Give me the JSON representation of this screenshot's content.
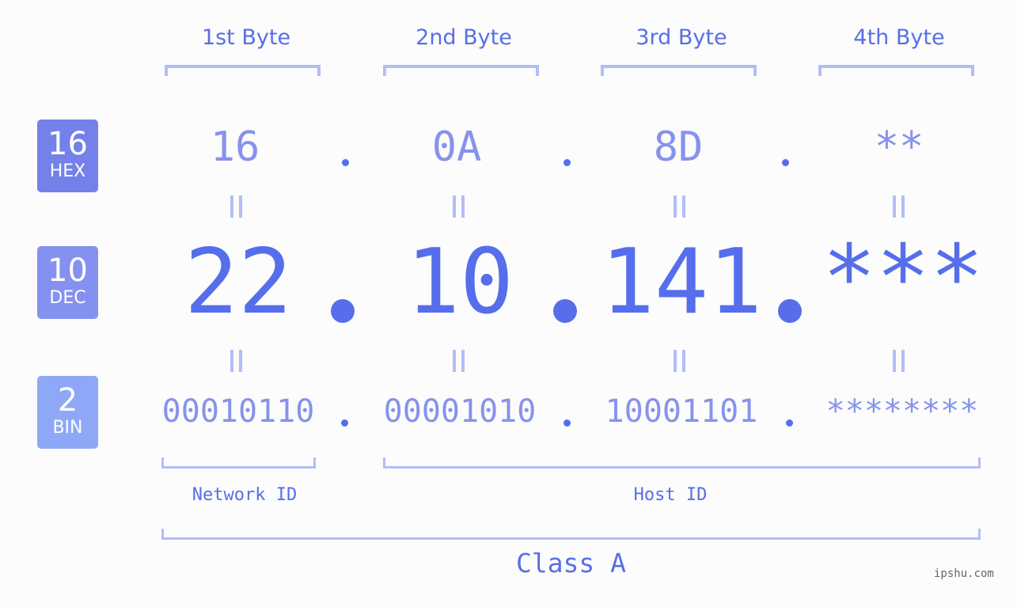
{
  "byte_headers": [
    "1st Byte",
    "2nd Byte",
    "3rd Byte",
    "4th Byte"
  ],
  "rows": {
    "hex": {
      "base": "16",
      "label": "HEX",
      "color": "#7481ea",
      "values": [
        "16",
        "0A",
        "8D",
        "**"
      ]
    },
    "dec": {
      "base": "10",
      "label": "DEC",
      "color": "#8491f0",
      "values": [
        "22",
        "10",
        "141",
        "***"
      ]
    },
    "bin": {
      "base": "2",
      "label": "BIN",
      "color": "#8fa7f7",
      "values": [
        "00010110",
        "00001010",
        "10001101",
        "********"
      ]
    }
  },
  "ip_address": "22.10.141.***",
  "network_id_label": "Network ID",
  "host_id_label": "Host ID",
  "class_label": "Class A",
  "watermark": "ipshu.com",
  "colors": {
    "accent": "#566eeb",
    "bracket": "#b3bdf9",
    "muted_value": "#8792ec",
    "background": "#fbfcfb"
  }
}
